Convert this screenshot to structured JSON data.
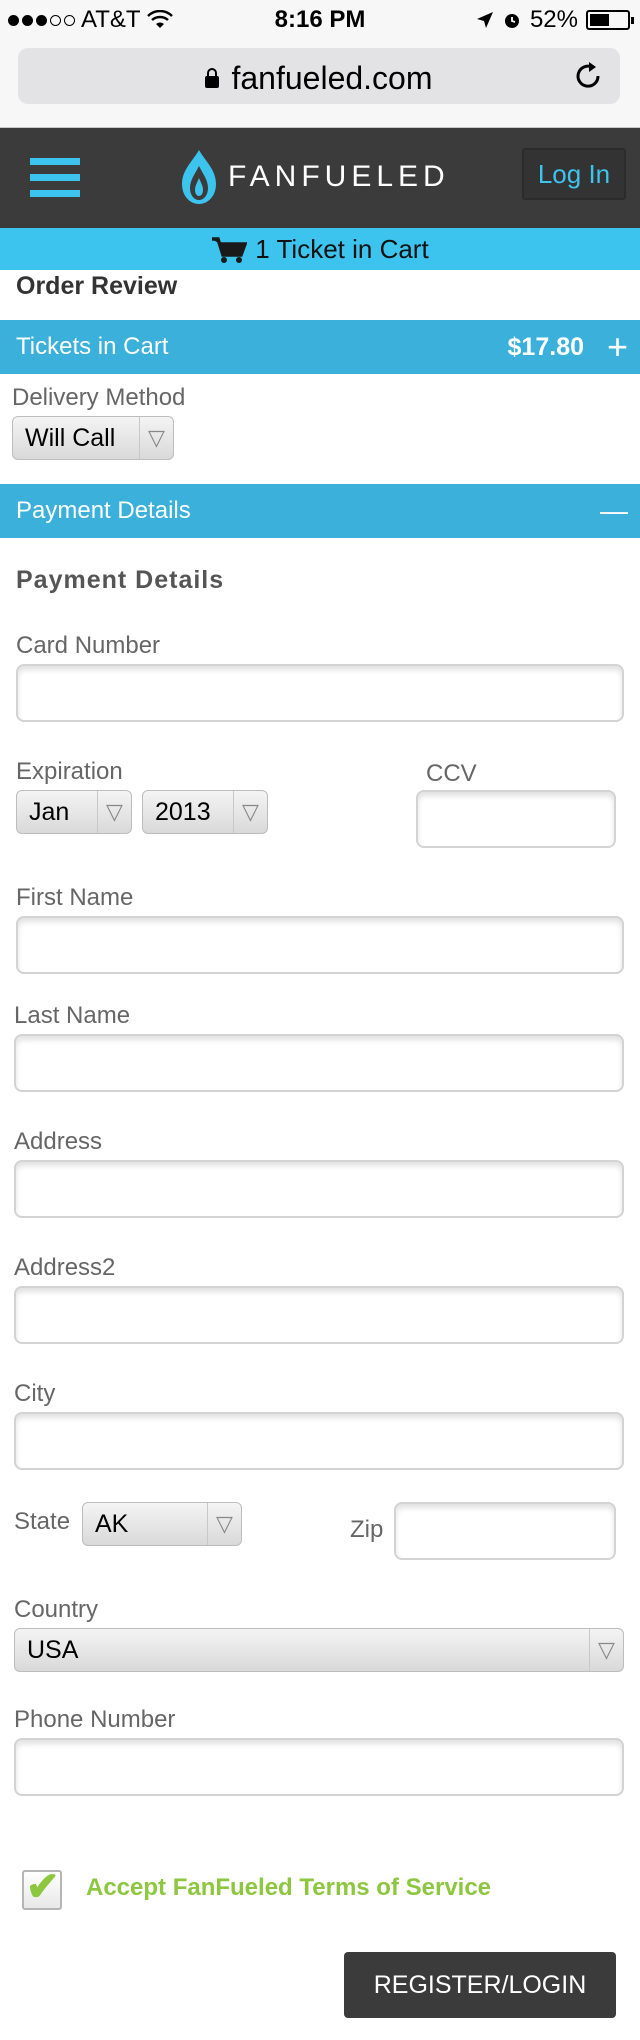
{
  "status_bar": {
    "carrier": "AT&T",
    "time": "8:16 PM",
    "battery_percent": "52%",
    "battery_level": 0.52,
    "icons": [
      "signal-dots-icon",
      "wifi-icon",
      "location-arrow-icon",
      "alarm-icon",
      "battery-icon"
    ]
  },
  "browser": {
    "url": "fanfueled.com",
    "icons": [
      "lock-icon",
      "reload-icon"
    ]
  },
  "header": {
    "logo_text": "FANFUELED",
    "login_label": "Log In",
    "accent_color": "#3cc3ee",
    "icons": [
      "hamburger-menu-icon",
      "flame-logo-icon"
    ]
  },
  "cart": {
    "label": "1 Ticket in Cart",
    "icon": "cart-icon"
  },
  "order_review": {
    "title": "Order Review"
  },
  "tickets_section": {
    "title": "Tickets in Cart",
    "price": "$17.80",
    "toggle": "+",
    "delivery_label": "Delivery Method",
    "delivery_value": "Will Call"
  },
  "payment_section": {
    "title": "Payment Details",
    "toggle": "—",
    "heading": "Payment Details",
    "card_number_label": "Card Number",
    "expiration_label": "Expiration",
    "exp_month": "Jan",
    "exp_year": "2013",
    "ccv_label": "CCV",
    "first_name_label": "First Name",
    "last_name_label": "Last Name",
    "address_label": "Address",
    "address2_label": "Address2",
    "city_label": "City",
    "state_label": "State",
    "state_value": "AK",
    "zip_label": "Zip",
    "country_label": "Country",
    "country_value": "USA",
    "phone_label": "Phone Number"
  },
  "terms": {
    "label": "Accept FanFueled Terms of Service",
    "checked": true,
    "check_color": "#8dc63f"
  },
  "actions": {
    "register_label": "REGISTER/LOGIN"
  }
}
